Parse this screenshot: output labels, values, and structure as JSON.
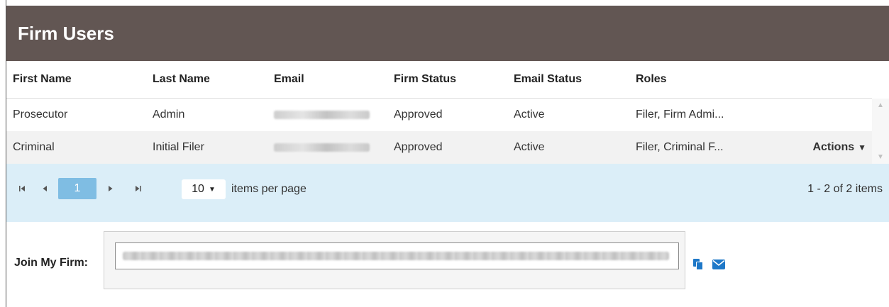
{
  "header": {
    "title": "Firm Users"
  },
  "columns": [
    "First Name",
    "Last Name",
    "Email",
    "Firm Status",
    "Email Status",
    "Roles"
  ],
  "rows": [
    {
      "first_name": "Prosecutor",
      "last_name": "Admin",
      "firm_status": "Approved",
      "email_status": "Active",
      "roles": "Filer, Firm Admi..."
    },
    {
      "first_name": "Criminal",
      "last_name": "Initial Filer",
      "firm_status": "Approved",
      "email_status": "Active",
      "roles": "Filer, Criminal F...",
      "actions_label": "Actions"
    }
  ],
  "pager": {
    "current_page": "1",
    "page_size": "10",
    "items_per_page_label": "items per page",
    "info": "1 - 2 of 2 items"
  },
  "join": {
    "label": "Join My Firm:"
  },
  "icons": {
    "first": "first-page-icon",
    "prev": "prev-page-icon",
    "next": "next-page-icon",
    "last": "last-page-icon",
    "copy": "copy-icon",
    "mail": "envelope-icon",
    "caret": "caret-down-icon"
  },
  "colors": {
    "header_bg": "#625653",
    "pager_bg": "#dbeef8",
    "current_page": "#7fbde3",
    "icon_blue": "#1e78c8"
  }
}
